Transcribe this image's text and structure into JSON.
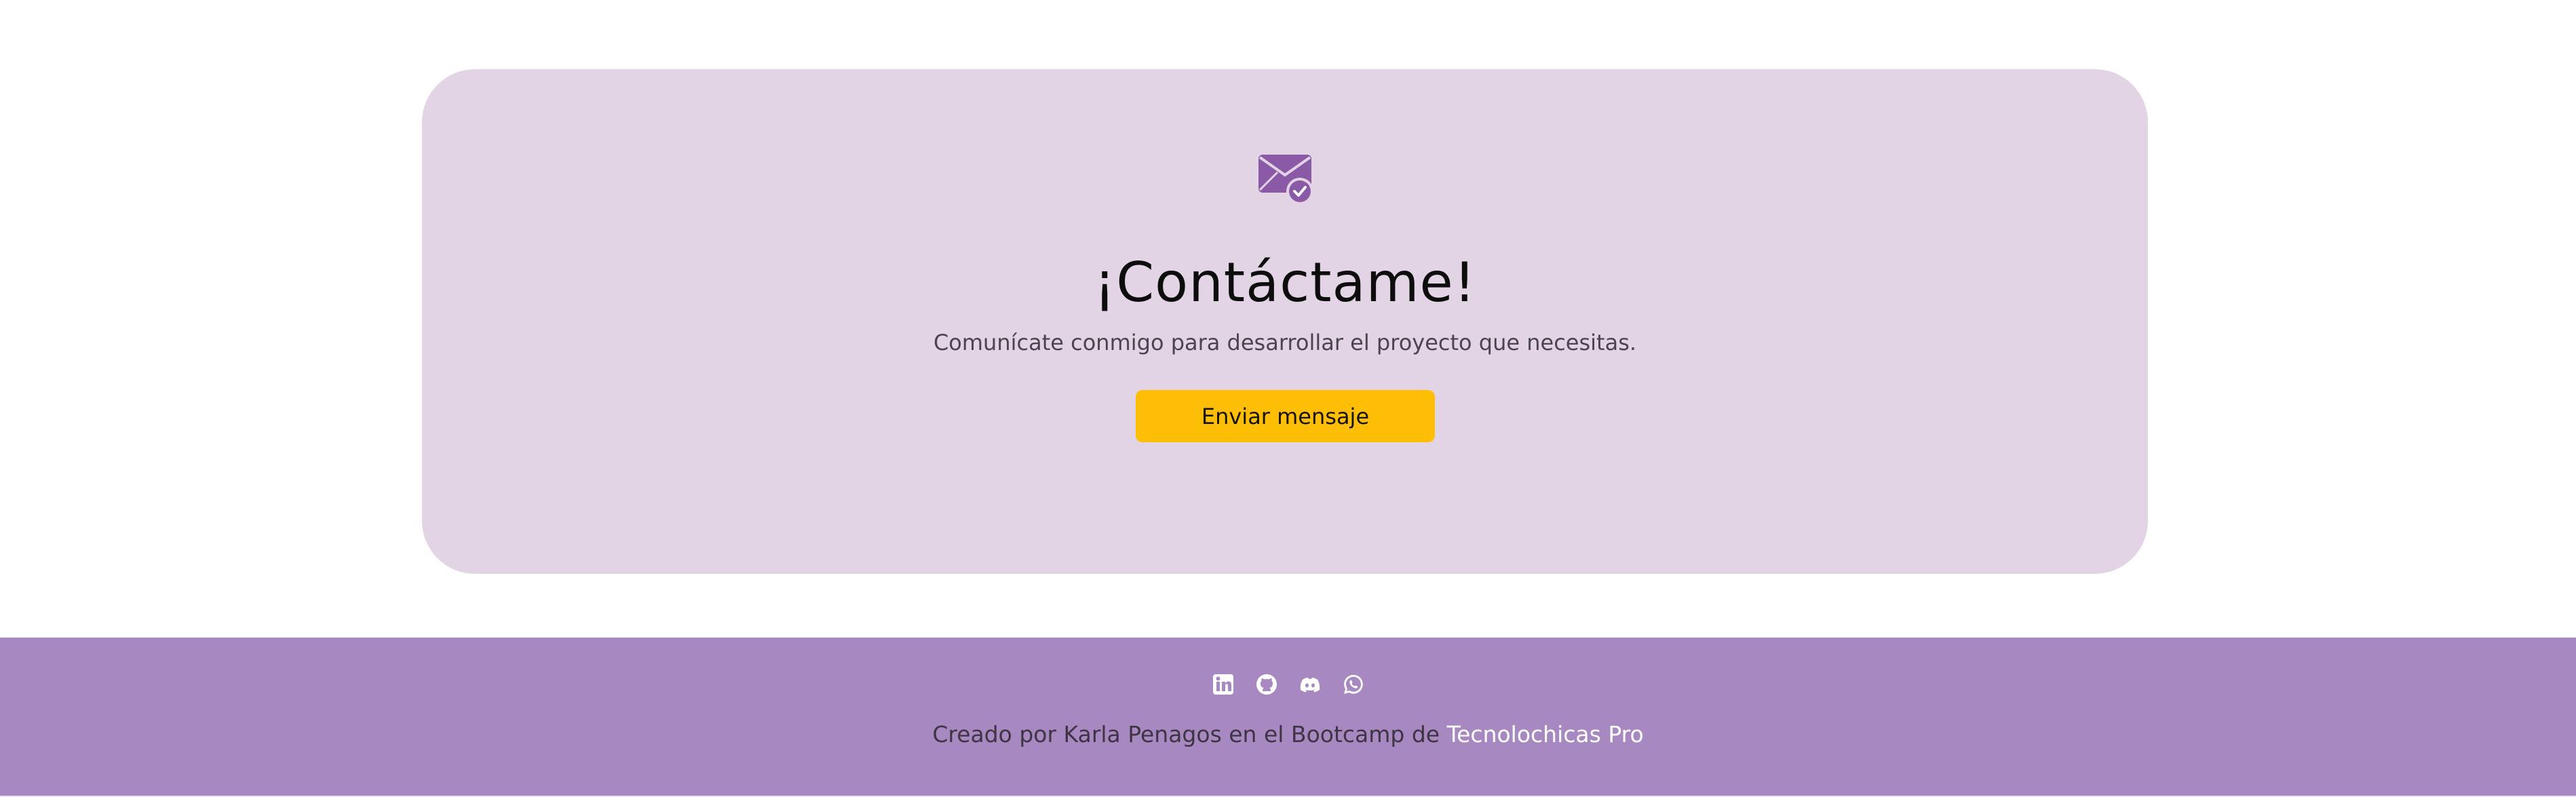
{
  "contact": {
    "icon": "mail-check-icon",
    "title": "¡Contáctame!",
    "subtitle": "Comunícate conmigo para desarrollar el proyecto que necesitas.",
    "button_label": "Enviar mensaje"
  },
  "footer": {
    "social_icons": [
      "linkedin-icon",
      "github-icon",
      "discord-icon",
      "whatsapp-icon"
    ],
    "credits_prefix": "Creado por Karla Penagos en el Bootcamp de ",
    "credits_link": "Tecnolochicas Pro"
  },
  "colors": {
    "card_background": "#e2d4e4",
    "accent_purple": "#8a5aa6",
    "button_yellow": "#fdbe05",
    "footer_background": "#a888c0",
    "link_white": "#ffffff"
  }
}
